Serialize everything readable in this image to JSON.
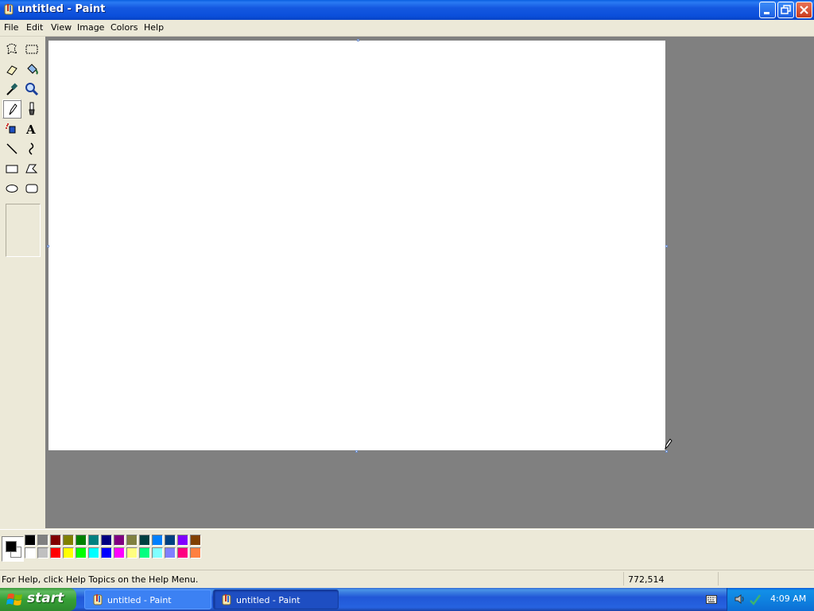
{
  "window": {
    "title": "untitled - Paint"
  },
  "menu": [
    "File",
    "Edit",
    "View",
    "Image",
    "Colors",
    "Help"
  ],
  "tools": [
    {
      "name": "free-form-select",
      "icon": "freeform-select-icon"
    },
    {
      "name": "select",
      "icon": "rect-select-icon"
    },
    {
      "name": "eraser",
      "icon": "eraser-icon"
    },
    {
      "name": "fill-with-color",
      "icon": "fill-bucket-icon"
    },
    {
      "name": "pick-color",
      "icon": "eyedropper-icon"
    },
    {
      "name": "magnifier",
      "icon": "magnifier-icon"
    },
    {
      "name": "pencil",
      "icon": "pencil-icon",
      "selected": true
    },
    {
      "name": "brush",
      "icon": "brush-icon"
    },
    {
      "name": "airbrush",
      "icon": "airbrush-icon"
    },
    {
      "name": "text",
      "icon": "text-icon"
    },
    {
      "name": "line",
      "icon": "line-icon"
    },
    {
      "name": "curve",
      "icon": "curve-icon"
    },
    {
      "name": "rectangle",
      "icon": "rectangle-icon"
    },
    {
      "name": "polygon",
      "icon": "polygon-icon"
    },
    {
      "name": "ellipse",
      "icon": "ellipse-icon"
    },
    {
      "name": "rounded-rectangle",
      "icon": "rounded-rect-icon"
    }
  ],
  "palette": {
    "foreground": "#000000",
    "background": "#FFFFFF",
    "top_row": [
      "#000000",
      "#808080",
      "#800000",
      "#808000",
      "#008000",
      "#008080",
      "#000080",
      "#800080",
      "#808040",
      "#004040",
      "#0080FF",
      "#004080",
      "#8000FF",
      "#804000"
    ],
    "bottom_row": [
      "#FFFFFF",
      "#C0C0C0",
      "#FF0000",
      "#FFFF00",
      "#00FF00",
      "#00FFFF",
      "#0000FF",
      "#FF00FF",
      "#FFFF80",
      "#00FF80",
      "#80FFFF",
      "#8080FF",
      "#FF0080",
      "#FF8040"
    ]
  },
  "status": {
    "help_text": "For Help, click Help Topics on the Help Menu.",
    "coords": "772,514"
  },
  "taskbar": {
    "start_label": "start",
    "tasks": [
      "untitled - Paint",
      "untitled - Paint"
    ],
    "clock": "4:09 AM"
  },
  "colors": {
    "workspace": "#808080",
    "titlebar": "#0B4FDB",
    "taskbar": "#2157D7"
  }
}
